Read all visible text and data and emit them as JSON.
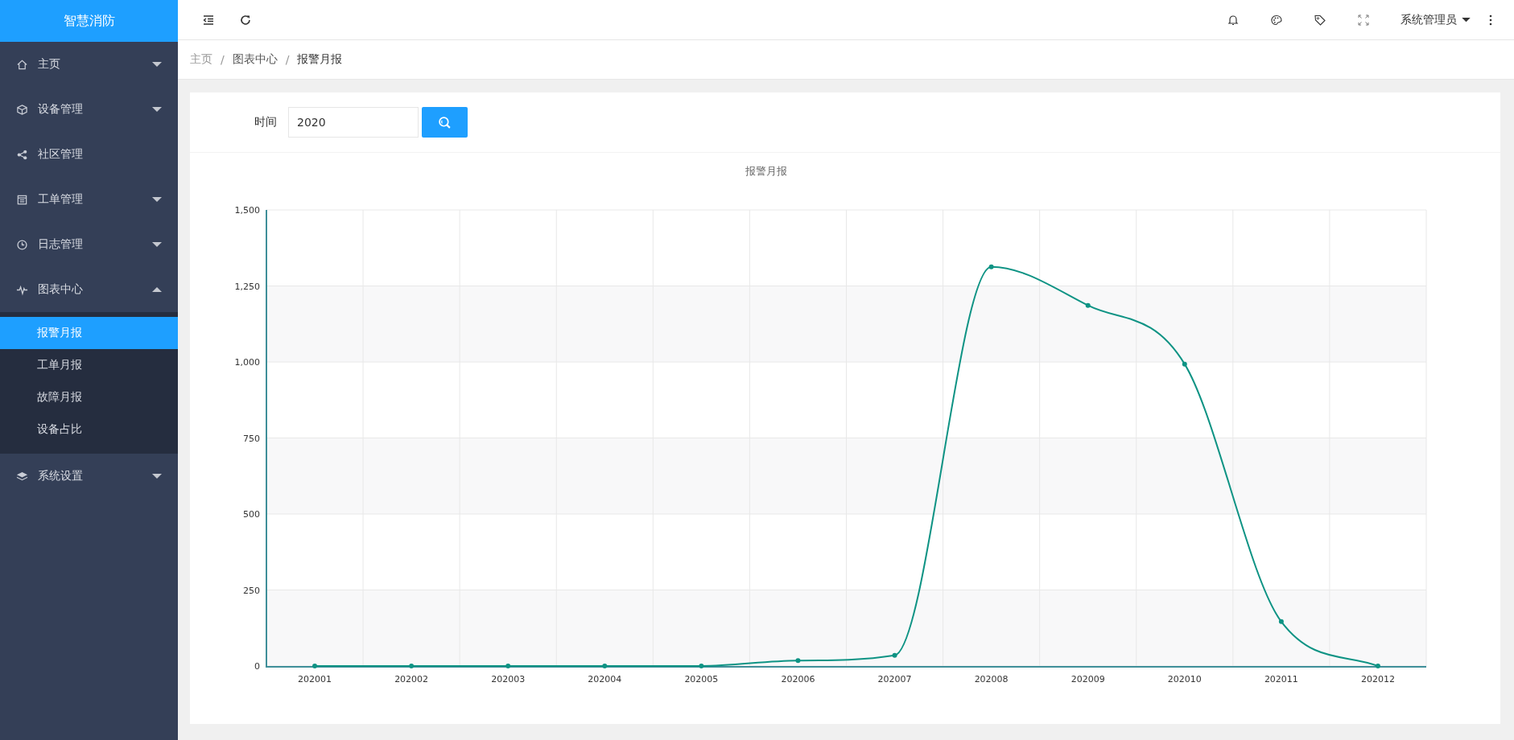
{
  "logo": "智慧消防",
  "sidebar": {
    "items": [
      {
        "label": "主页",
        "kind": "home",
        "expanded": false
      },
      {
        "label": "设备管理",
        "kind": "cube",
        "expanded": false
      },
      {
        "label": "社区管理",
        "kind": "share"
      },
      {
        "label": "工单管理",
        "kind": "board",
        "expanded": false
      },
      {
        "label": "日志管理",
        "kind": "clock",
        "expanded": false
      },
      {
        "label": "图表中心",
        "kind": "pulse",
        "expanded": true,
        "children": [
          {
            "label": "报警月报",
            "selected": true
          },
          {
            "label": "工单月报",
            "selected": false
          },
          {
            "label": "故障月报",
            "selected": false
          },
          {
            "label": "设备占比",
            "selected": false
          }
        ]
      },
      {
        "label": "系统设置",
        "kind": "layers",
        "expanded": false
      }
    ]
  },
  "topbar": {
    "user": "系统管理员"
  },
  "breadcrumb": {
    "separator": "/",
    "items": [
      "主页",
      "图表中心",
      "报警月报"
    ]
  },
  "filter": {
    "label": "时间",
    "value": "2020"
  },
  "chart": {
    "chart_data": {
      "type": "line",
      "title": "报警月报",
      "categories": [
        "202001",
        "202002",
        "202003",
        "202004",
        "202005",
        "202006",
        "202007",
        "202008",
        "202009",
        "202010",
        "202011",
        "202012"
      ],
      "grid": true,
      "series": [
        {
          "color": "#0e9384",
          "marker": true,
          "values": [
            0,
            0,
            0,
            0,
            0,
            18,
            35,
            1313,
            1186,
            993,
            146,
            0
          ]
        }
      ],
      "ylim": [
        0,
        1500
      ],
      "yticks": [
        {
          "value": 0,
          "label": "0"
        },
        {
          "value": 250,
          "label": "250"
        },
        {
          "value": 500,
          "label": "500"
        },
        {
          "value": 750,
          "label": "750"
        },
        {
          "value": 1000,
          "label": "1,000"
        },
        {
          "value": 1250,
          "label": "1,250"
        },
        {
          "value": 1500,
          "label": "1,500"
        }
      ]
    }
  }
}
